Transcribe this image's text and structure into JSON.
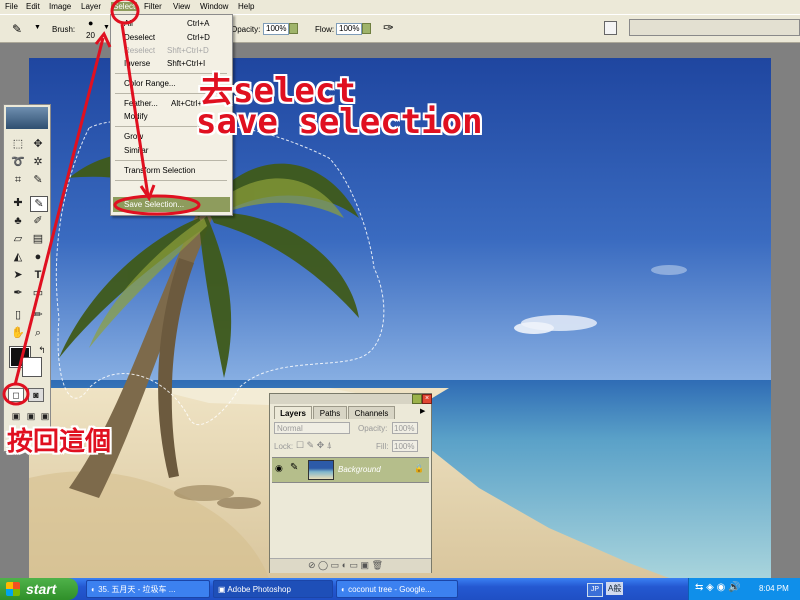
{
  "menubar": [
    "File",
    "Edit",
    "Image",
    "Layer",
    "Select",
    "Filter",
    "View",
    "Window",
    "Help"
  ],
  "options": {
    "brush_label": "Brush:",
    "brush_size": "20",
    "opacity_label": "Opacity:",
    "opacity_value": "100%",
    "flow_label": "Flow:",
    "flow_value": "100%"
  },
  "select_menu": {
    "items": [
      {
        "label": "All",
        "shortcut": "Ctrl+A"
      },
      {
        "label": "Deselect",
        "shortcut": "Ctrl+D"
      },
      {
        "label": "Reselect",
        "shortcut": "Shft+Ctrl+D"
      },
      {
        "label": "Inverse",
        "shortcut": "Shft+Ctrl+I"
      },
      {
        "label": "Color Range...",
        "shortcut": ""
      },
      {
        "label": "Feather...",
        "shortcut": "Alt+Ctrl+D"
      },
      {
        "label": "Modify",
        "shortcut": ""
      },
      {
        "label": "Grow",
        "shortcut": ""
      },
      {
        "label": "Similar",
        "shortcut": ""
      },
      {
        "label": "Transform Selection",
        "shortcut": ""
      },
      {
        "label": "Save Selection...",
        "shortcut": ""
      }
    ]
  },
  "layers_palette": {
    "tabs": [
      "Layers",
      "Paths",
      "Channels"
    ],
    "blend_mode": "Normal",
    "opacity_label": "Opacity:",
    "opacity_value": "100%",
    "lock_label": "Lock:",
    "fill_label": "Fill:",
    "fill_value": "100%",
    "layer_name": "Background"
  },
  "annotations": {
    "line1": "去select",
    "line2": "save selection",
    "quickmask": "按回這個"
  },
  "taskbar": {
    "start": "start",
    "buttons": [
      "35. 五月天 - 垃圾车 ...",
      "Adobe Photoshop",
      "coconut tree - Google..."
    ],
    "lang": "JP",
    "ime": "A般",
    "clock": "8:04 PM"
  },
  "colors": {
    "annotation": "#e01020",
    "menu_highlight": "#8e9c5d",
    "taskbar": "#2458d1",
    "sky": "#2e56a8",
    "sea": "#7fb9c9",
    "sand": "#e7d8b7"
  }
}
